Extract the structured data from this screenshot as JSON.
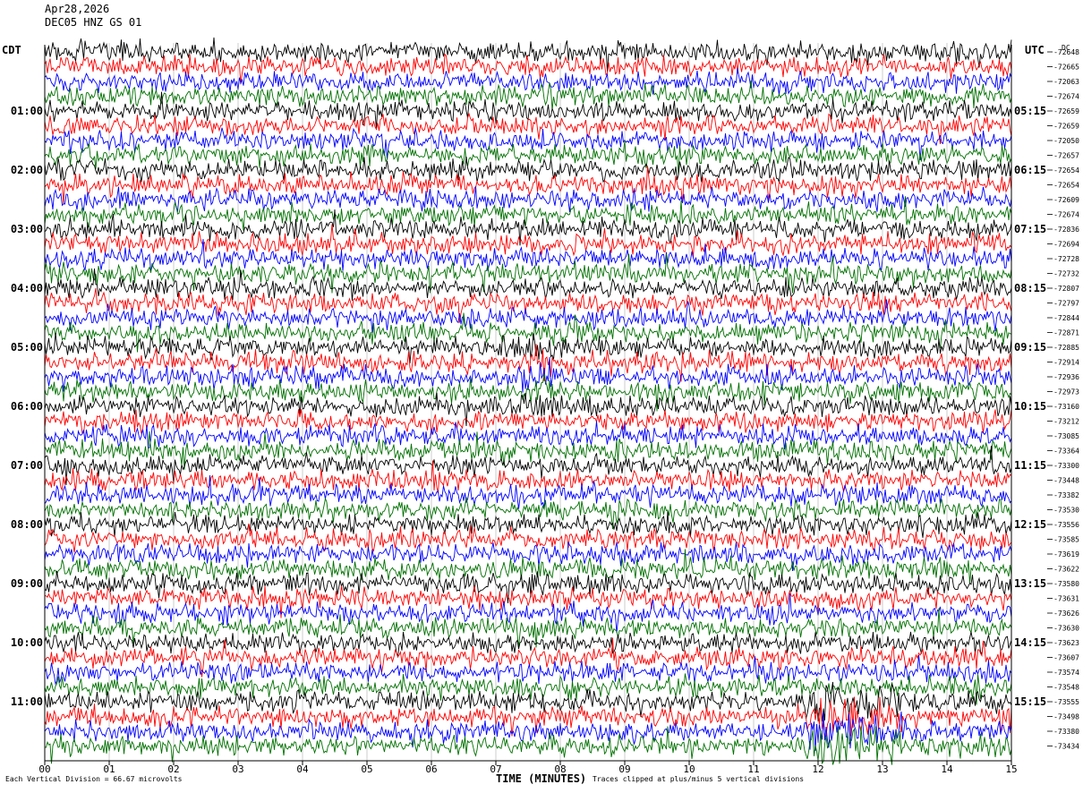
{
  "header": {
    "date": "Apr28,2026",
    "station": "DEC05 HNZ GS 01"
  },
  "labels": {
    "left_timezone": "CDT",
    "right_timezone": "UTC",
    "dc_label": "DC",
    "x_axis_title": "TIME (MINUTES)",
    "vertical_division": "Each Vertical Division =    66.67 microvolts",
    "clip_note": "Traces clipped at plus/minus 5 vertical divisions"
  },
  "colors": {
    "trace_cycle": [
      "#000000",
      "#ff0000",
      "#0000ff",
      "#007000"
    ],
    "background": "#ffffff",
    "axis": "#000000"
  },
  "chart_data": {
    "type": "line",
    "title": "Apr28,2026",
    "subtitle": "DEC05 HNZ GS 01",
    "xlabel": "TIME (MINUTES)",
    "ylabel": "",
    "x_ticks": [
      "00",
      "01",
      "02",
      "03",
      "04",
      "05",
      "06",
      "07",
      "08",
      "09",
      "10",
      "11",
      "12",
      "13",
      "14",
      "15"
    ],
    "xlim": [
      0,
      15
    ],
    "rows_per_hour": 4,
    "row_count": 48,
    "left_hour_labels": [
      "01:00",
      "02:00",
      "03:00",
      "04:00",
      "05:00",
      "06:00",
      "07:00",
      "08:00",
      "09:00",
      "10:00",
      "11:00"
    ],
    "right_hour_labels": [
      "05:15",
      "06:15",
      "07:15",
      "08:15",
      "09:15",
      "10:15",
      "11:15",
      "12:15",
      "13:15",
      "14:15",
      "15:15"
    ],
    "dc_offsets": [
      -72648,
      -72665,
      -72063,
      -72674,
      -72659,
      -72659,
      -72050,
      -72657,
      -72654,
      -72654,
      -72609,
      -72674,
      -72836,
      -72694,
      -72728,
      -72732,
      -72807,
      -72797,
      -72844,
      -72871,
      -72885,
      -72914,
      -72936,
      -72973,
      -73160,
      -73212,
      -73085,
      -73364,
      -73300,
      -73448,
      -73382,
      -73530,
      -73556,
      -73585,
      -73619,
      -73622,
      -73580,
      -73631,
      -73626,
      -73630,
      -73623,
      -73607,
      -73574,
      -73548,
      -73555,
      -73498,
      -73380,
      -73434
    ],
    "series_color_cycle": [
      "black",
      "red",
      "blue",
      "green"
    ],
    "vertical_division_microvolts": 66.67,
    "clip_divisions": 5,
    "grid": false,
    "legend": "none"
  }
}
